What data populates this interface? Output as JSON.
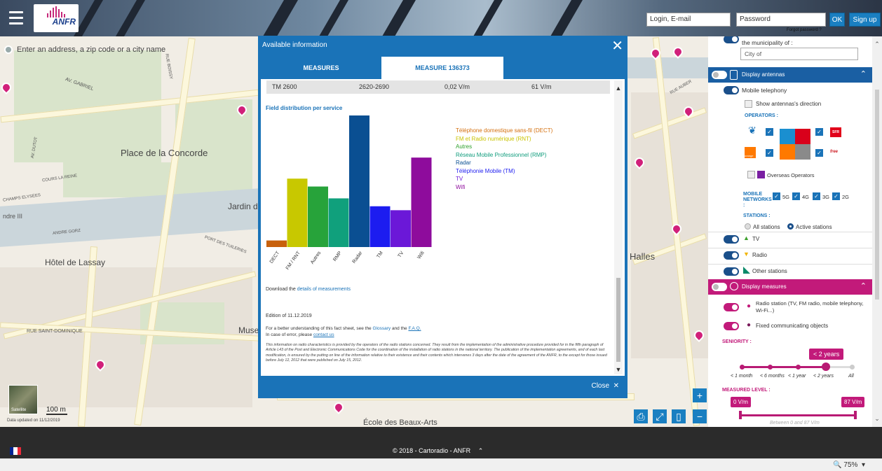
{
  "header": {
    "login_placeholder": "Login, E-mail",
    "password_placeholder": "Password",
    "ok_label": "OK",
    "signup_label": "Sign up",
    "forgot_label": "Forgot password ?",
    "logo_text": "ANFR"
  },
  "map": {
    "search_placeholder": "Enter an address, a zip code or a city name",
    "labels": [
      "AV. GABRIEL",
      "Place de la Concorde",
      "Jardin d",
      "Hôtel de Lassay",
      "RUE SAINT-DOMINIQUE",
      "Muse",
      "École des Beaux-Arts",
      "Halles",
      "ANDRE GORZ",
      "CHAMPS ELYSEES",
      "ndre III",
      "PORT DES TUILERIES",
      "COURS LA REINE",
      "RUE BOISSY",
      "AV. DUTOT",
      "RUE AUBER"
    ],
    "satellite_label": "Satellite",
    "scale_label": "100 m",
    "data_updated": "Data updated on 11/12/2019"
  },
  "modal": {
    "title": "Available information",
    "tabs": [
      {
        "label": "MEASURES"
      },
      {
        "label": "MEASURE 136373"
      }
    ],
    "row": {
      "service": "TM 2600",
      "band": "2620-2690",
      "value": "0,02 V/m",
      "limit": "61 V/m"
    },
    "field_title": "Field distribution per service",
    "download_prefix": "Download the ",
    "download_link": "details of measurements",
    "edition": "Edition of 11.12.2019",
    "understanding_prefix": "For a better understanding of this fact sheet, see the ",
    "glossary": "Glossary",
    "and": " and the ",
    "faq": "F.A.Q.",
    "error_prefix": "In case of error, please ",
    "contact": "contact us",
    "disclaimer": "This information on radio characteristics is provided by the operators of the radio stations concerned. They result from the implementation of the administrative procedure provided for in the fifth paragraph of Article L43 of the Post and Electronic Communications Code for the coordination of the installation of radio stations in the national territory. The publication of the implementation agreements, and of each last modification, is ensured by the putting on line of the information relative to their existence and their contents which intervenes 3 days after the date of the agreement of the ANFR, to the except for those issued before July 12, 2012 that were published on July 15, 2012.",
    "footer_close": "Close"
  },
  "chart_data": {
    "type": "bar",
    "categories": [
      "DECT",
      "FM / RNT",
      "Autres",
      "RMP",
      "Radar",
      "TM",
      "TV",
      "Wifi"
    ],
    "values": [
      0.05,
      0.52,
      0.46,
      0.37,
      1.0,
      0.31,
      0.28,
      0.68
    ],
    "colors": [
      "#c8610c",
      "#c8c800",
      "#27a33a",
      "#10a07c",
      "#0a4f92",
      "#1c1cf0",
      "#6b18d8",
      "#8e0c9c"
    ],
    "legend": [
      {
        "label": "Téléphone domestique sans-fil (DECT)",
        "color": "#d4700f"
      },
      {
        "label": "FM et Radio numérique (RNT)",
        "color": "#c9c300"
      },
      {
        "label": "Autres",
        "color": "#2ea02c"
      },
      {
        "label": "Réseau Mobile Professionnel (RMP)",
        "color": "#0f9c7c"
      },
      {
        "label": "Radar",
        "color": "#0a4f92"
      },
      {
        "label": "Téléphonie Mobile (TM)",
        "color": "#1c1cf0"
      },
      {
        "label": "TV",
        "color": "#6b18d8"
      },
      {
        "label": "Wifi",
        "color": "#8e0c9c"
      }
    ]
  },
  "panel": {
    "municipality_label": "the municipality of :",
    "city_placeholder": "City of",
    "display_antennas": "Display antennas",
    "mobile_telephony": "Mobile telephony",
    "show_direction": "Show antennas's direction",
    "operators_label": "OPERATORS :",
    "overseas": "Overseas Operators",
    "mobile_networks": "MOBILE NETWORKS :",
    "networks": [
      "5G",
      "4G",
      "3G",
      "2G"
    ],
    "stations_label": "STATIONS :",
    "all_stations": "All stations",
    "active_stations": "Active stations",
    "tv": "TV",
    "radio": "Radio",
    "other_stations": "Other stations",
    "display_measures": "Display measures",
    "radio_station": "Radio station (TV, FM radio, mobile telephony, Wi-Fi...)",
    "fixed_objects": "Fixed communicating objects",
    "seniority_label": "SENIORITY :",
    "seniority_value": "< 2 years",
    "seniority_ticks": [
      "< 1 month",
      "< 6 months",
      "< 1 year",
      "< 2 years",
      "All"
    ],
    "measured_level_label": "MEASURED LEVEL :",
    "level_min": "0 V/m",
    "level_max": "87 V/m",
    "level_range_text": "Between 0 and 87 V/m",
    "operator_sfr": "SFR",
    "operator_free": "free",
    "operator_orange": "orange"
  },
  "footer": {
    "copyright": "© 2018 - Cartoradio - ANFR",
    "zoom": "75%"
  }
}
